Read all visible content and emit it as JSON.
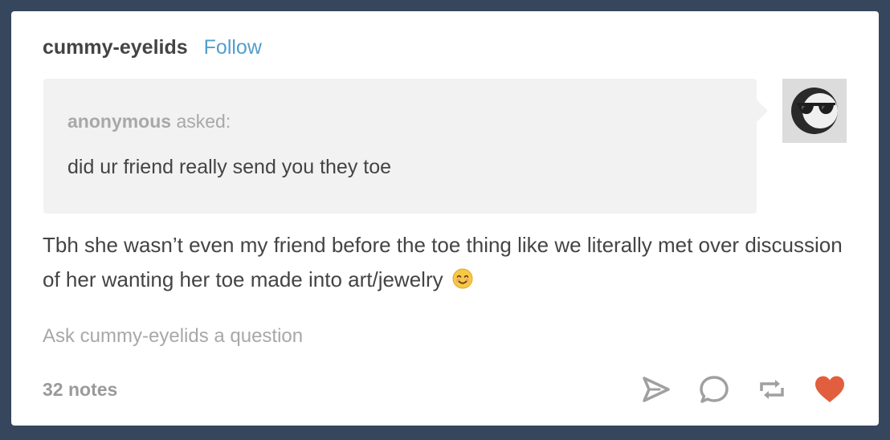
{
  "post": {
    "username": "cummy-eyelids",
    "follow_label": "Follow",
    "asker_name": "anonymous",
    "asked_label": "asked:",
    "question": "did ur friend really send you they toe",
    "answer": "Tbh she wasn’t even my friend before the toe thing like we literally met over discussion of her wanting her toe made into art/jewelry",
    "answer_emoji": "smiling-face-emoji",
    "ask_link": "Ask cummy-eyelids a question",
    "notes": "32 notes"
  },
  "icons": {
    "share": "share-arrow-icon",
    "reply": "reply-bubble-icon",
    "reblog": "reblog-icon",
    "like": "heart-icon"
  },
  "colors": {
    "background": "#36465d",
    "follow": "#529ecc",
    "like": "#e15f3e",
    "icon_gray": "#a0a0a0"
  }
}
